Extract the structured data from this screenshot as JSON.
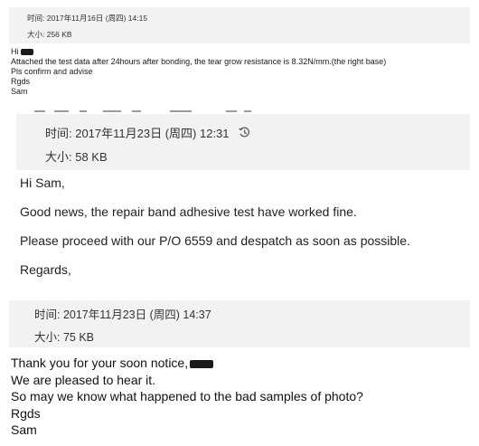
{
  "messages": [
    {
      "time": "时间: 2017年11月16日 (周四) 14:15",
      "size": "大小: 256 KB",
      "greeting": "Hi",
      "lines": [
        "Attached the test data after 24hours after bonding, the tear grow resistance is 8.32N/mm.(the right base)",
        "Pls confirm and advise",
        "Rgds",
        "Sam"
      ]
    },
    {
      "time": "时间: 2017年11月23日 (周四) 12:31",
      "size": "大小: 58 KB",
      "icon": "clock-history-icon",
      "lines": [
        "Hi Sam,",
        "Good news, the repair band adhesive test have worked fine.",
        "Please proceed with our P/O 6559 and despatch as soon as possible.",
        "Regards,"
      ]
    },
    {
      "time": "时间: 2017年11月23日 (周四) 14:37",
      "size": "大小: 75 KB",
      "first_line": "Thank you for your soon notice,",
      "lines": [
        "We are pleased to hear it.",
        "So may we know what happened to the bad samples of photo?",
        "Rgds",
        "Sam"
      ]
    }
  ]
}
